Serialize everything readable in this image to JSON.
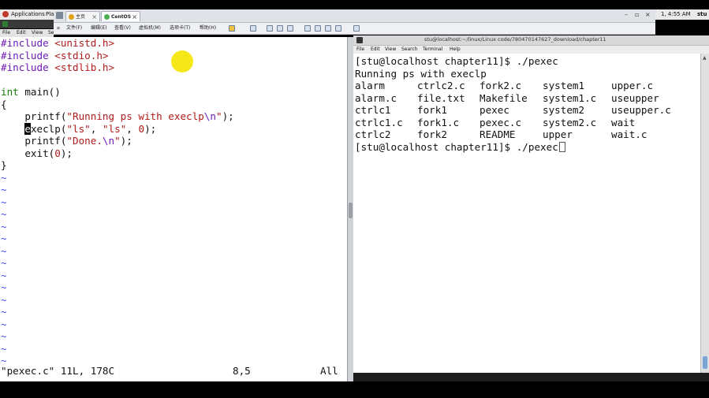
{
  "topbar": {
    "applications_label": "Applications",
    "places_label": "Pla",
    "time": "1, 4:55 AM",
    "user": "stu"
  },
  "vm_tabs": {
    "home_tab": "主页",
    "centos_tab": "CentOS"
  },
  "vm_menu": {
    "file": "文件(F)",
    "edit": "编辑(E)",
    "view": "查看(V)",
    "vm": "虚拟机(M)",
    "tabs": "选项卡(T)",
    "help": "帮助(H)"
  },
  "gvim": {
    "menu": {
      "file": "File",
      "edit": "Edit",
      "view": "View",
      "more": "Se"
    },
    "lines": [
      {
        "kind": "include",
        "kw": "#include ",
        "hdr": "<unistd.h>"
      },
      {
        "kind": "include",
        "kw": "#include ",
        "hdr": "<stdio.h>"
      },
      {
        "kind": "include",
        "kw": "#include ",
        "hdr": "<stdlib.h>"
      },
      {
        "kind": "blank"
      },
      {
        "kind": "main",
        "type": "int",
        "rest": " main()"
      },
      {
        "kind": "plain",
        "text": "{"
      },
      {
        "kind": "printf1",
        "pre": "    printf(",
        "s1": "\"Running ps with execlp",
        "esc": "\\n",
        "s2": "\"",
        "post": ");"
      },
      {
        "kind": "execlp",
        "pre": "    ",
        "curchar": "e",
        "fn": "xeclp(",
        "s1": "\"ls\"",
        "c1": ", ",
        "s2": "\"ls\"",
        "c2": ", ",
        "num": "0",
        "post": ");"
      },
      {
        "kind": "printf2",
        "pre": "    printf(",
        "s1": "\"Done.",
        "esc": "\\n",
        "s2": "\"",
        "post": ");"
      },
      {
        "kind": "exit",
        "pre": "    exit(",
        "num": "0",
        "post": ");"
      },
      {
        "kind": "plain",
        "text": "}"
      }
    ],
    "tilde": "~",
    "tilde_count": 16,
    "status": {
      "file": "\"pexec.c\" 11L, 178C",
      "pos": "8,5",
      "scroll": "All"
    }
  },
  "terminal": {
    "title": "stu@localhost:~/linux/Linux code/780470147627_download/chapter11",
    "menu": [
      "File",
      "Edit",
      "View",
      "Search",
      "Terminal",
      "Help"
    ],
    "prompt1": "[stu@localhost chapter11]$ ./pexec",
    "output1": "Running ps with execlp",
    "ls_rows": [
      [
        "alarm",
        "ctrlc2.c",
        "fork2.c",
        "system1",
        "upper.c"
      ],
      [
        "alarm.c",
        "file.txt",
        "Makefile",
        "system1.c",
        "useupper"
      ],
      [
        "ctrlc1",
        "fork1",
        "pexec",
        "system2",
        "useupper.c"
      ],
      [
        "ctrlc1.c",
        "fork1.c",
        "pexec.c",
        "system2.c",
        "wait"
      ],
      [
        "ctrlc2",
        "fork2",
        "README",
        "upper",
        "wait.c"
      ]
    ],
    "prompt2": "[stu@localhost chapter11]$ ./pexec"
  },
  "colors": {
    "vim_preproc": "#6b1bb3",
    "vim_string": "#b01b1b",
    "vim_type": "#1f7a10",
    "vim_tilde": "#4848ff",
    "cursor_highlight": "#f4e600"
  }
}
